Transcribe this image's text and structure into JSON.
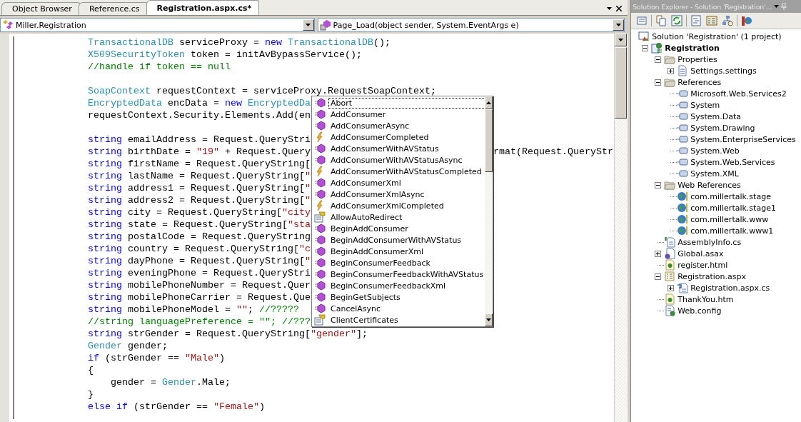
{
  "editor": {
    "tabs": [
      {
        "label": "Object Browser",
        "selected": false
      },
      {
        "label": "Reference.cs",
        "selected": false
      },
      {
        "label": "Registration.aspx.cs*",
        "selected": true
      }
    ],
    "type_dropdown": {
      "value": "Miller.Registration"
    },
    "member_dropdown": {
      "value": "Page_Load(object sender, System.EventArgs e)"
    },
    "code_lines": [
      {
        "tokens": [
          {
            "text": "TransactionalDB",
            "kind": "type"
          },
          {
            "text": " serviceProxy = ",
            "kind": "plain"
          },
          {
            "text": "new",
            "kind": "keyword"
          },
          {
            "text": " TransactionalDB",
            "kind": "type"
          },
          {
            "text": "();",
            "kind": "plain"
          }
        ]
      },
      {
        "tokens": [
          {
            "text": "X509SecurityToken",
            "kind": "type"
          },
          {
            "text": " token = initAvBypassService();",
            "kind": "plain"
          }
        ]
      },
      {
        "tokens": [
          {
            "text": "//handle if token == null",
            "kind": "comment"
          }
        ]
      },
      {
        "kind": "blank"
      },
      {
        "tokens": [
          {
            "text": "SoapContext",
            "kind": "type"
          },
          {
            "text": " requestContext = serviceProxy.",
            "kind": "plain"
          },
          {
            "text": "RequestSoapContext",
            "kind": "error"
          },
          {
            "text": ";",
            "kind": "plain"
          }
        ]
      },
      {
        "tokens": [
          {
            "text": "EncryptedData",
            "kind": "type"
          },
          {
            "text": " encData = ",
            "kind": "plain"
          },
          {
            "text": "new",
            "kind": "keyword"
          },
          {
            "text": " EncryptedDa",
            "kind": "type"
          }
        ]
      },
      {
        "tokens": [
          {
            "text": "requestContext.Security.Elements.Add(en",
            "kind": "plain"
          }
        ]
      },
      {
        "kind": "blank"
      },
      {
        "tokens": [
          {
            "text": "string",
            "kind": "keyword"
          },
          {
            "text": " emailAddress = Request.QueryStri",
            "kind": "plain"
          }
        ]
      },
      {
        "tokens": [
          {
            "text": "string",
            "kind": "keyword"
          },
          {
            "text": " birthDate = ",
            "kind": "plain"
          },
          {
            "text": "\"19\"",
            "kind": "string"
          },
          {
            "text": " + Request.Query",
            "kind": "plain"
          }
        ],
        "after": [
          {
            "text": "rmat(Request.QueryStr",
            "kind": "plain"
          }
        ]
      },
      {
        "tokens": [
          {
            "text": "string",
            "kind": "keyword"
          },
          {
            "text": " firstName = Request.QueryString[",
            "kind": "plain"
          }
        ]
      },
      {
        "tokens": [
          {
            "text": "string",
            "kind": "keyword"
          },
          {
            "text": " lastName = Request.QueryString[",
            "kind": "plain"
          },
          {
            "text": "\"",
            "kind": "string"
          }
        ]
      },
      {
        "tokens": [
          {
            "text": "string",
            "kind": "keyword"
          },
          {
            "text": " address1 = Request.QueryString[",
            "kind": "plain"
          },
          {
            "text": "\"",
            "kind": "string"
          }
        ]
      },
      {
        "tokens": [
          {
            "text": "string",
            "kind": "keyword"
          },
          {
            "text": " address2 = Request.QueryString[",
            "kind": "plain"
          },
          {
            "text": "\"",
            "kind": "string"
          }
        ]
      },
      {
        "tokens": [
          {
            "text": "string",
            "kind": "keyword"
          },
          {
            "text": " city = Request.QueryString[",
            "kind": "plain"
          },
          {
            "text": "\"city",
            "kind": "string"
          }
        ]
      },
      {
        "tokens": [
          {
            "text": "string",
            "kind": "keyword"
          },
          {
            "text": " state = Request.QueryString[",
            "kind": "plain"
          },
          {
            "text": "\"sta",
            "kind": "string"
          }
        ]
      },
      {
        "tokens": [
          {
            "text": "string",
            "kind": "keyword"
          },
          {
            "text": " postalCode = Request.QueryString",
            "kind": "plain"
          }
        ]
      },
      {
        "tokens": [
          {
            "text": "string",
            "kind": "keyword"
          },
          {
            "text": " country = Request.QueryString[",
            "kind": "plain"
          },
          {
            "text": "\"c",
            "kind": "string"
          }
        ]
      },
      {
        "tokens": [
          {
            "text": "string",
            "kind": "keyword"
          },
          {
            "text": " dayPhone = Request.QueryString[",
            "kind": "plain"
          },
          {
            "text": "\"",
            "kind": "string"
          }
        ]
      },
      {
        "tokens": [
          {
            "text": "string",
            "kind": "keyword"
          },
          {
            "text": " eveningPhone = Request.QueryStri",
            "kind": "plain"
          }
        ]
      },
      {
        "tokens": [
          {
            "text": "string",
            "kind": "keyword"
          },
          {
            "text": " mobilePhoneNumber = Request.Quer",
            "kind": "plain"
          }
        ]
      },
      {
        "tokens": [
          {
            "text": "string",
            "kind": "keyword"
          },
          {
            "text": " mobilePhoneCarrier = Request.Que",
            "kind": "plain"
          }
        ]
      },
      {
        "tokens": [
          {
            "text": "string",
            "kind": "keyword"
          },
          {
            "text": " mobilePhoneModel = ",
            "kind": "plain"
          },
          {
            "text": "\"\"",
            "kind": "string"
          },
          {
            "text": "; ",
            "kind": "plain"
          },
          {
            "text": "//?????",
            "kind": "comment"
          }
        ]
      },
      {
        "tokens": [
          {
            "text": "//string languagePreference = \"\"; //???",
            "kind": "comment"
          }
        ]
      },
      {
        "tokens": [
          {
            "text": "string",
            "kind": "keyword"
          },
          {
            "text": " strGender = Request.QueryString[",
            "kind": "plain"
          },
          {
            "text": "\"gender\"",
            "kind": "string"
          },
          {
            "text": "];",
            "kind": "plain"
          }
        ]
      },
      {
        "tokens": [
          {
            "text": "Gender",
            "kind": "type"
          },
          {
            "text": " gender;",
            "kind": "plain"
          }
        ]
      },
      {
        "tokens": [
          {
            "text": "if",
            "kind": "keyword"
          },
          {
            "text": " (strGender == ",
            "kind": "plain"
          },
          {
            "text": "\"Male\"",
            "kind": "string"
          },
          {
            "text": ")",
            "kind": "plain"
          }
        ]
      },
      {
        "tokens": [
          {
            "text": "{",
            "kind": "plain"
          }
        ]
      },
      {
        "tokens": [
          {
            "text": "    gender = ",
            "kind": "plain"
          },
          {
            "text": "Gender",
            "kind": "type"
          },
          {
            "text": ".Male;",
            "kind": "plain"
          }
        ]
      },
      {
        "tokens": [
          {
            "text": "}",
            "kind": "plain"
          }
        ]
      },
      {
        "tokens": [
          {
            "text": "else",
            "kind": "keyword"
          },
          {
            "text": " if",
            "kind": "keyword"
          },
          {
            "text": " (strGender == ",
            "kind": "plain"
          },
          {
            "text": "\"Female\"",
            "kind": "string"
          },
          {
            "text": ")",
            "kind": "plain"
          }
        ]
      }
    ],
    "completion_list": [
      {
        "label": "Abort",
        "kind": "method",
        "selected": true
      },
      {
        "label": "AddConsumer",
        "kind": "method",
        "selected": false
      },
      {
        "label": "AddConsumerAsync",
        "kind": "method",
        "selected": false
      },
      {
        "label": "AddConsumerCompleted",
        "kind": "event",
        "selected": false
      },
      {
        "label": "AddConsumerWithAVStatus",
        "kind": "method",
        "selected": false
      },
      {
        "label": "AddConsumerWithAVStatusAsync",
        "kind": "method",
        "selected": false
      },
      {
        "label": "AddConsumerWithAVStatusCompleted",
        "kind": "event",
        "selected": false
      },
      {
        "label": "AddConsumerXml",
        "kind": "method",
        "selected": false
      },
      {
        "label": "AddConsumerXmlAsync",
        "kind": "method",
        "selected": false
      },
      {
        "label": "AddConsumerXmlCompleted",
        "kind": "event",
        "selected": false
      },
      {
        "label": "AllowAutoRedirect",
        "kind": "property",
        "selected": false
      },
      {
        "label": "BeginAddConsumer",
        "kind": "method",
        "selected": false
      },
      {
        "label": "BeginAddConsumerWithAVStatus",
        "kind": "method",
        "selected": false
      },
      {
        "label": "BeginAddConsumerXml",
        "kind": "method",
        "selected": false
      },
      {
        "label": "BeginConsumerFeedback",
        "kind": "method",
        "selected": false
      },
      {
        "label": "BeginConsumerFeedbackWithAVStatus",
        "kind": "method",
        "selected": false
      },
      {
        "label": "BeginConsumerFeedbackXml",
        "kind": "method",
        "selected": false
      },
      {
        "label": "BeginGetSubjects",
        "kind": "method",
        "selected": false
      },
      {
        "label": "CancelAsync",
        "kind": "method",
        "selected": false
      },
      {
        "label": "ClientCertificates",
        "kind": "property",
        "selected": false
      }
    ]
  },
  "solution_explorer": {
    "title": "Solution Explorer - Solution 'Registration'...",
    "root": {
      "label": "Solution 'Registration' (1 project)",
      "kind": "solution"
    },
    "tree": [
      {
        "label": "Registration",
        "kind": "project",
        "expanded": true,
        "children": [
          {
            "label": "Properties",
            "kind": "folder",
            "expanded": true,
            "children": [
              {
                "label": "Settings.settings",
                "kind": "settings",
                "expanded": false
              }
            ]
          },
          {
            "label": "References",
            "kind": "folder",
            "expanded": true,
            "children": [
              {
                "label": "Microsoft.Web.Services2",
                "kind": "reference"
              },
              {
                "label": "System",
                "kind": "reference"
              },
              {
                "label": "System.Data",
                "kind": "reference"
              },
              {
                "label": "System.Drawing",
                "kind": "reference"
              },
              {
                "label": "System.EnterpriseServices",
                "kind": "reference"
              },
              {
                "label": "System.Web",
                "kind": "reference"
              },
              {
                "label": "System.Web.Services",
                "kind": "reference"
              },
              {
                "label": "System.XML",
                "kind": "reference"
              }
            ]
          },
          {
            "label": "Web References",
            "kind": "folder",
            "expanded": true,
            "children": [
              {
                "label": "com.millertalk.stage",
                "kind": "webref"
              },
              {
                "label": "com.millertalk.stage1",
                "kind": "webref"
              },
              {
                "label": "com.millertalk.www",
                "kind": "webref"
              },
              {
                "label": "com.millertalk.www1",
                "kind": "webref"
              }
            ]
          },
          {
            "label": "AssemblyInfo.cs",
            "kind": "csfile"
          },
          {
            "label": "Global.asax",
            "kind": "asax",
            "expanded": false
          },
          {
            "label": "register.html",
            "kind": "html"
          },
          {
            "label": "Registration.aspx",
            "kind": "aspx",
            "expanded": true,
            "children": [
              {
                "label": "Registration.aspx.cs",
                "kind": "codebehind",
                "expanded": false
              }
            ]
          },
          {
            "label": "ThankYou.htm",
            "kind": "html"
          },
          {
            "label": "Web.config",
            "kind": "config"
          }
        ]
      }
    ]
  }
}
